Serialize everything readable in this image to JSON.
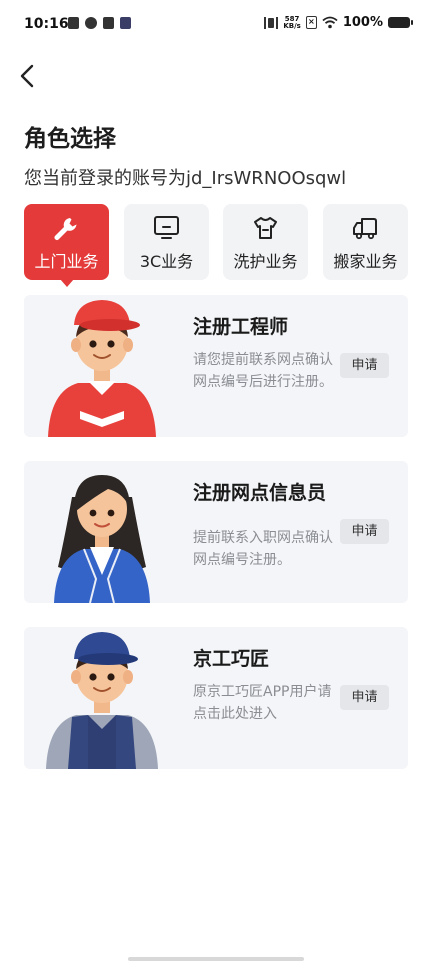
{
  "status_bar": {
    "time": "10:16",
    "net_speed_value": "587",
    "net_speed_unit": "KB/s",
    "battery_percent": "100%"
  },
  "header": {
    "back_icon": "chevron-left-icon",
    "title": "角色选择",
    "account_text": "您当前登录的账号为jd_IrsWRNOOsqwl"
  },
  "tabs": [
    {
      "label": "上门业务",
      "icon": "wrench-icon",
      "active": true
    },
    {
      "label": "3C业务",
      "icon": "monitor-icon",
      "active": false
    },
    {
      "label": "洗护业务",
      "icon": "shirt-icon",
      "active": false
    },
    {
      "label": "搬家业务",
      "icon": "truck-icon",
      "active": false
    }
  ],
  "roles": [
    {
      "title": "注册工程师",
      "desc": "请您提前联系网点确认网点编号后进行注册。",
      "button": "申请"
    },
    {
      "title": "注册网点信息员",
      "desc": "提前联系入职网点确认网点编号注册。",
      "button": "申请"
    },
    {
      "title": "京工巧匠",
      "desc": "原京工巧匠APP用户请点击此处进入",
      "button": "申请"
    }
  ],
  "colors": {
    "accent": "#e43a3a",
    "card_bg": "#f4f5f8",
    "tab_bg": "#f2f3f5"
  }
}
